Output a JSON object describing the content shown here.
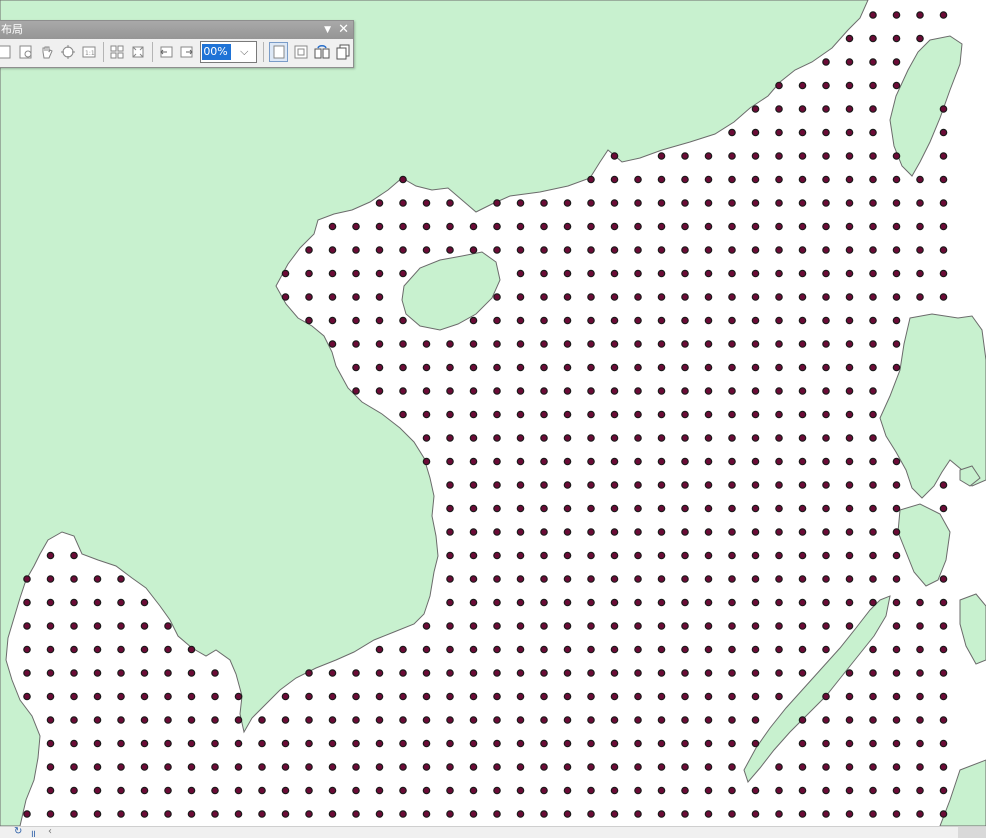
{
  "map": {
    "land_color": "#c8f1cf",
    "coast_color": "#6b6b6b",
    "point_color": "#6b0b36",
    "point_outline": "#1a1a1a"
  },
  "toolbar": {
    "title": "布局",
    "zoom_value": "00%",
    "dropdown_icon": "triangle-down-icon",
    "close_icon": "close-icon"
  },
  "statusbar": {
    "refresh_icon": "refresh-icon",
    "pause_icon": "pause-icon"
  }
}
